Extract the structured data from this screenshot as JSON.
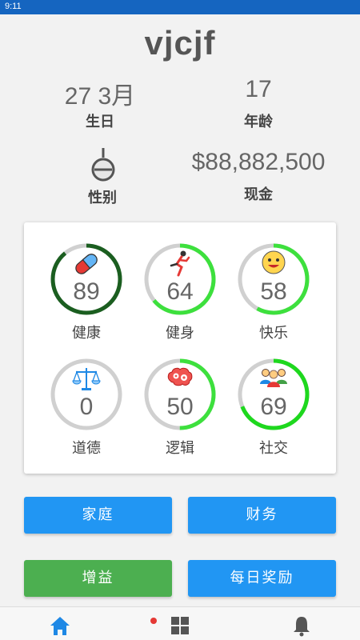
{
  "status_bar": {
    "time": "9:11"
  },
  "player": {
    "name": "vjcjf"
  },
  "info": {
    "birthday_value": "27 3月",
    "birthday_label": "生日",
    "age_value": "17",
    "age_label": "年龄",
    "gender_label": "性别",
    "gender_icon": "male-symbol-icon",
    "cash_value": "$88,882,500",
    "cash_label": "现金"
  },
  "stats": [
    {
      "label": "健康",
      "value": "89",
      "percent": 89,
      "color": "#1b5e20",
      "icon": "pill-icon"
    },
    {
      "label": "健身",
      "value": "64",
      "percent": 64,
      "color": "#3de03d",
      "icon": "running-man-icon"
    },
    {
      "label": "快乐",
      "value": "58",
      "percent": 58,
      "color": "#3de03d",
      "icon": "smiley-face-icon"
    },
    {
      "label": "道德",
      "value": "0",
      "percent": 0,
      "color": "#3de03d",
      "icon": "scales-icon"
    },
    {
      "label": "逻辑",
      "value": "50",
      "percent": 50,
      "color": "#3de03d",
      "icon": "brain-gears-icon"
    },
    {
      "label": "社交",
      "value": "69",
      "percent": 69,
      "color": "#1ed81e",
      "icon": "people-group-icon"
    }
  ],
  "buttons": {
    "family": "家庭",
    "finance": "财务",
    "boost": "增益",
    "daily_reward": "每日奖励"
  },
  "colors": {
    "primary_blue": "#2196f3",
    "green": "#4caf50",
    "ring_track": "#d0d0d0"
  }
}
